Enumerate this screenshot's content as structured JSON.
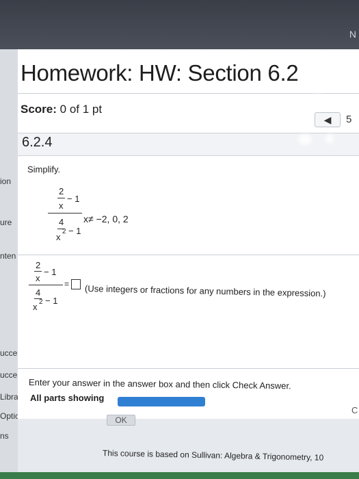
{
  "window": {
    "corner_glyph": "N"
  },
  "header": {
    "title": "Homework: HW: Section 6.2",
    "score_label": "Score:",
    "score_value": "0 of 1 pt",
    "nav_prev_glyph": "◀",
    "nav_number": "5"
  },
  "question": {
    "number": "6.2.4",
    "prompt": "Simplify.",
    "condition": "x≠ −2, 0, 2",
    "expr": {
      "num_top": "2",
      "num_bottom": "x",
      "num_minus": "− 1",
      "den_top": "4",
      "den_bottom": "x",
      "den_exp": "2",
      "den_minus": "− 1"
    },
    "answer_eq": "=",
    "answer_instruction": "(Use integers or fractions for any numbers in the expression.)"
  },
  "left_sidebar": {
    "items": [
      "ion",
      "ure",
      "nten",
      "ucces",
      "ucces",
      "Libra",
      "Options",
      "ns"
    ]
  },
  "footer": {
    "enter_instruction": "Enter your answer in the answer box and then click Check Answer.",
    "parts_label": "All parts showing",
    "progress_fraction": 1.0,
    "ok_label": "OK",
    "right_glyph": "C",
    "course_note": "This course is based on Sullivan: Algebra & Trigonometry, 10"
  },
  "colors": {
    "accent": "#2f7fd3",
    "panel": "#ffffff",
    "top_bar": "#3a3e47"
  }
}
